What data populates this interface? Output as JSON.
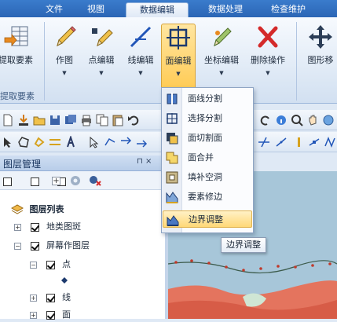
{
  "menu_tabs": [
    "文件",
    "视图",
    "数据编辑",
    "数据处理",
    "检查维护"
  ],
  "active_tab_index": 2,
  "ribbon": {
    "buttons": [
      {
        "label": "提取要素",
        "icon": "grid-table-icon"
      },
      {
        "label": "作图",
        "icon": "pencil-icon"
      },
      {
        "label": "点编辑",
        "icon": "point-edit-icon"
      },
      {
        "label": "线编辑",
        "icon": "line-edit-icon"
      },
      {
        "label": "面编辑",
        "icon": "polygon-edit-icon"
      },
      {
        "label": "坐标编辑",
        "icon": "coordinate-edit-icon"
      },
      {
        "label": "删除操作",
        "icon": "red-x-delete-icon"
      },
      {
        "label": "图形移",
        "icon": "move-arrows-icon"
      }
    ],
    "group_label": "提取要素"
  },
  "layer_panel": {
    "title": "图层管理",
    "pin_glyph": "⊓ ×",
    "root": "图层列表",
    "rows": [
      {
        "label": "地类图斑",
        "expander": "+",
        "checked": true
      },
      {
        "label": "屏幕作图层",
        "expander": "−",
        "checked": true
      },
      {
        "label": "点",
        "expander": "−",
        "checked": true
      },
      {
        "label": "线",
        "expander": "+",
        "checked": true
      },
      {
        "label": "面",
        "expander": "+",
        "checked": true
      }
    ]
  },
  "dropdown": {
    "items": [
      {
        "label": "面线分割",
        "icon": "split-by-line-icon"
      },
      {
        "label": "选择分割",
        "icon": "select-split-icon"
      },
      {
        "label": "面切割面",
        "icon": "polygon-cut-icon"
      },
      {
        "label": "面合并",
        "icon": "polygon-merge-icon"
      },
      {
        "label": "填补空洞",
        "icon": "fill-hole-icon"
      },
      {
        "label": "要素修边",
        "icon": "feature-trim-icon"
      },
      {
        "label": "边界调整",
        "icon": "boundary-adjust-icon"
      }
    ],
    "highlighted_index": 6
  },
  "tooltip": "边界调整",
  "colors": {
    "title_bar": "#2b66b5",
    "highlight": "#ffd877",
    "map_water": "#a7c6d9",
    "map_land": "#e4745e"
  }
}
